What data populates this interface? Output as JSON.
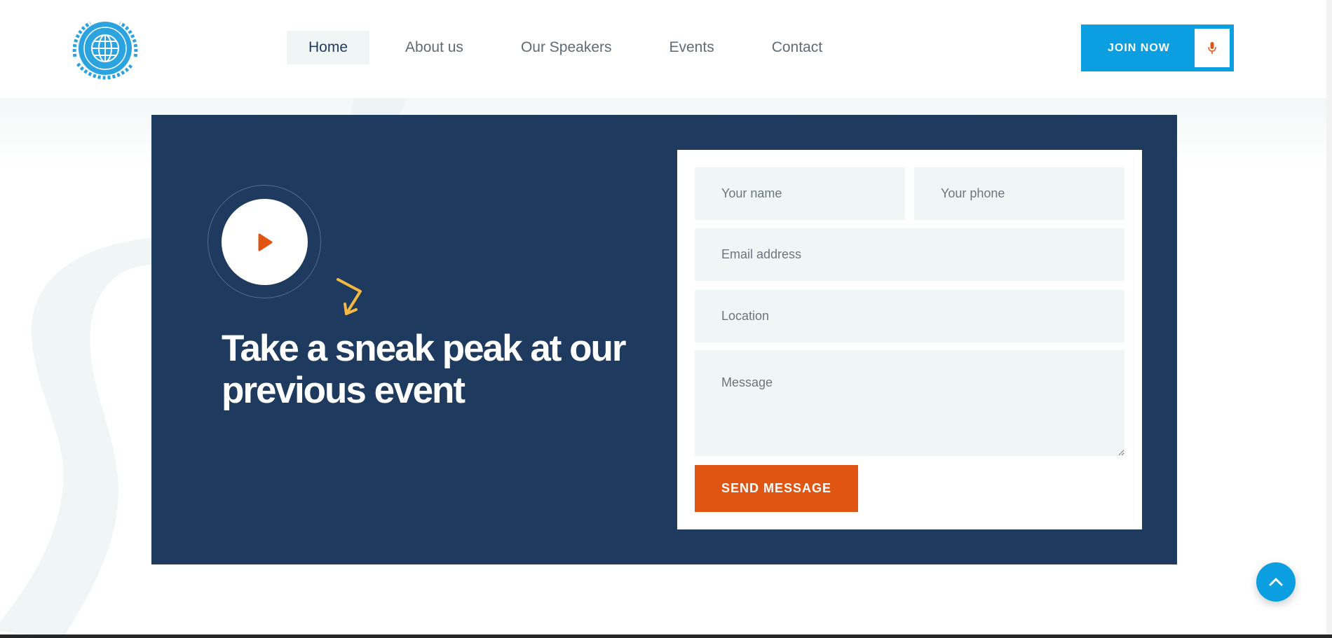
{
  "header": {
    "nav": [
      {
        "label": "Home",
        "active": true
      },
      {
        "label": "About us"
      },
      {
        "label": "Our Speakers"
      },
      {
        "label": "Events"
      },
      {
        "label": "Contact"
      }
    ],
    "join_label": "JOIN NOW",
    "join_icon": "microphone-icon"
  },
  "hero": {
    "headline": "Take a sneak peak at our previous event",
    "play_icon": "play-icon"
  },
  "form": {
    "name_placeholder": "Your name",
    "phone_placeholder": "Your phone",
    "email_placeholder": "Email address",
    "location_placeholder": "Location",
    "message_placeholder": "Message",
    "submit_label": "SEND MESSAGE"
  },
  "colors": {
    "navy": "#1e3a5f",
    "accent_blue": "#0b9ee0",
    "accent_orange": "#e05512",
    "arrow_yellow": "#f5b841",
    "field_bg": "#f0f5f5"
  }
}
